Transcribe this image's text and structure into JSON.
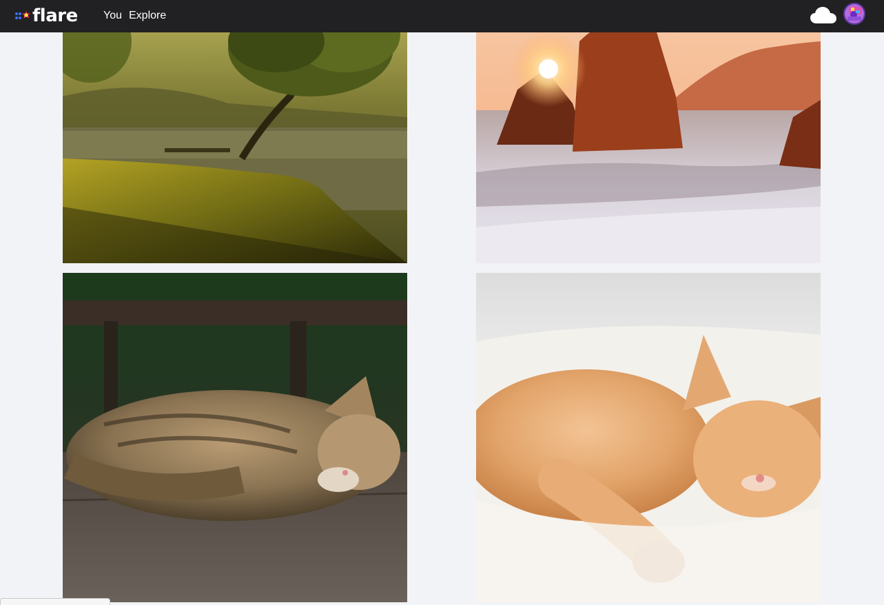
{
  "app": {
    "logo_text": "flare",
    "brand_colors": {
      "bar": "#212124",
      "logo_dots": [
        "#3b6fff",
        "#3b6fff",
        "#ff2f5e"
      ],
      "logo_star": "#ff2f5e"
    }
  },
  "nav": {
    "items": [
      {
        "label": "You"
      },
      {
        "label": "Explore"
      }
    ]
  },
  "header_icons": {
    "upload": "cloud-upload-icon",
    "account": "user-avatar"
  },
  "photos": [
    {
      "subject": "lake-tree-sunrise"
    },
    {
      "subject": "sea-rocks-sunset"
    },
    {
      "subject": "tabby-cat-sleeping"
    },
    {
      "subject": "orange-cat-sleeping"
    }
  ],
  "colors": {
    "page_background": "#f2f3f6"
  }
}
